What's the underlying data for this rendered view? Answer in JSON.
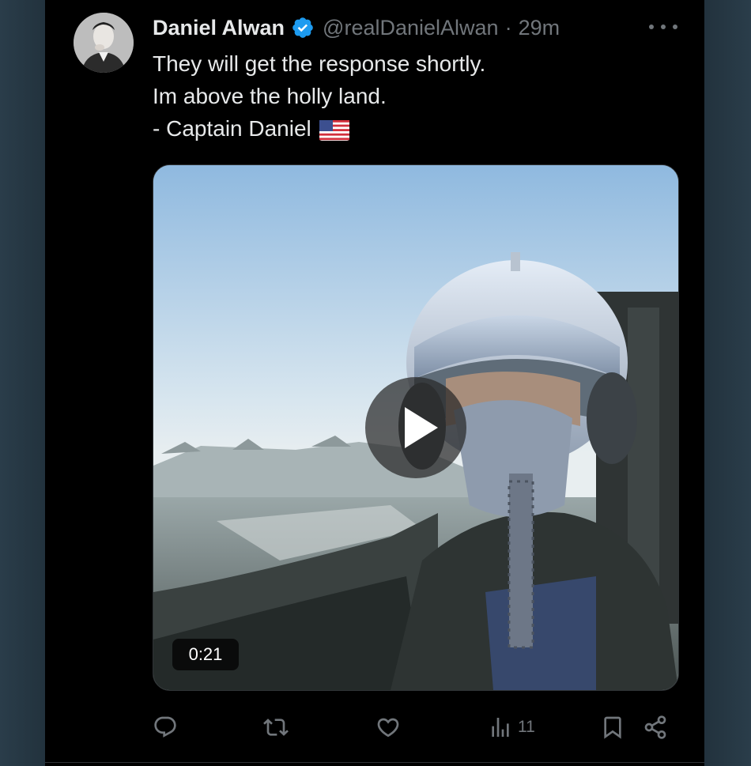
{
  "tweet": {
    "author": {
      "name": "Daniel Alwan",
      "handle": "@realDanielAlwan",
      "verified": true,
      "avatar_icon": "profile-photo"
    },
    "separator": "·",
    "timestamp": "29m",
    "more_icon": "ellipsis-icon",
    "text_lines": [
      "They will get the response shortly.",
      "Im above the holly land.",
      "- Captain Daniel"
    ],
    "flag_icon": "us-flag-emoji",
    "media": {
      "type": "video",
      "description_icon": "video-thumbnail",
      "duration": "0:21"
    },
    "actions": {
      "reply_icon": "reply-icon",
      "retweet_icon": "retweet-icon",
      "like_icon": "heart-icon",
      "views_icon": "analytics-icon",
      "views_count": "11",
      "bookmark_icon": "bookmark-icon",
      "share_icon": "share-icon"
    }
  },
  "colors": {
    "background": "#000000",
    "text": "#e7e9ea",
    "muted": "#71767b",
    "verified": "#1d9bf0",
    "page_frame": "#253845"
  }
}
